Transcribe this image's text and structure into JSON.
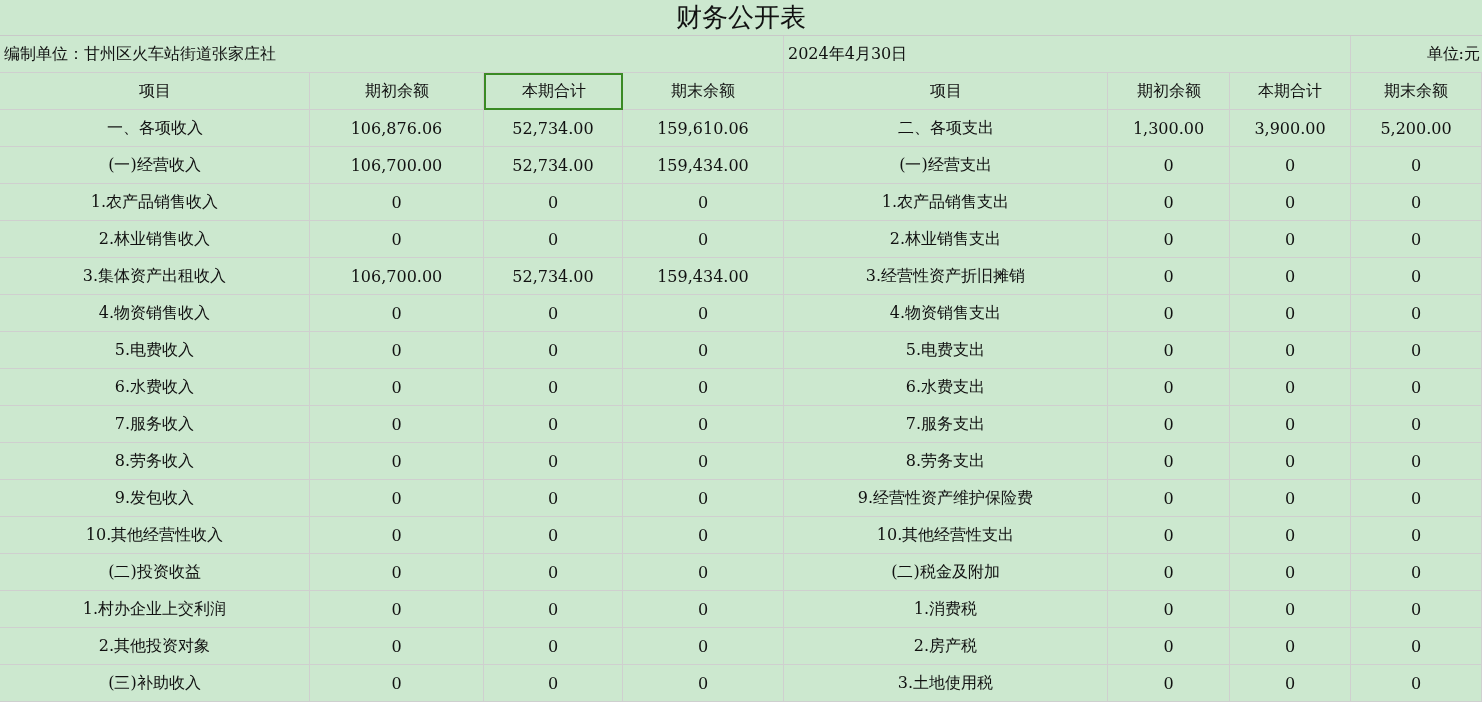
{
  "title": "财务公开表",
  "info": {
    "unit_name": "编制单位：甘州区火车站街道张家庄社",
    "date": "2024年4月30日",
    "currency": "单位:元"
  },
  "columns": [
    {
      "label": "项目",
      "selected": false
    },
    {
      "label": "期初余额",
      "selected": false
    },
    {
      "label": "本期合计",
      "selected": true
    },
    {
      "label": "期末余额",
      "selected": false
    },
    {
      "label": "项目",
      "selected": false
    },
    {
      "label": "期初余额",
      "selected": false
    },
    {
      "label": "本期合计",
      "selected": false
    },
    {
      "label": "期末余额",
      "selected": false
    }
  ],
  "rows": [
    [
      "一、各项收入",
      "106,876.06",
      "52,734.00",
      "159,610.06",
      "二、各项支出",
      "1,300.00",
      "3,900.00",
      "5,200.00"
    ],
    [
      "(一)经营收入",
      "106,700.00",
      "52,734.00",
      "159,434.00",
      "(一)经营支出",
      "0",
      "0",
      "0"
    ],
    [
      "1.农产品销售收入",
      "0",
      "0",
      "0",
      "1.农产品销售支出",
      "0",
      "0",
      "0"
    ],
    [
      "2.林业销售收入",
      "0",
      "0",
      "0",
      "2.林业销售支出",
      "0",
      "0",
      "0"
    ],
    [
      "3.集体资产出租收入",
      "106,700.00",
      "52,734.00",
      "159,434.00",
      "3.经营性资产折旧摊销",
      "0",
      "0",
      "0"
    ],
    [
      "4.物资销售收入",
      "0",
      "0",
      "0",
      "4.物资销售支出",
      "0",
      "0",
      "0"
    ],
    [
      "5.电费收入",
      "0",
      "0",
      "0",
      "5.电费支出",
      "0",
      "0",
      "0"
    ],
    [
      "6.水费收入",
      "0",
      "0",
      "0",
      "6.水费支出",
      "0",
      "0",
      "0"
    ],
    [
      "7.服务收入",
      "0",
      "0",
      "0",
      "7.服务支出",
      "0",
      "0",
      "0"
    ],
    [
      "8.劳务收入",
      "0",
      "0",
      "0",
      "8.劳务支出",
      "0",
      "0",
      "0"
    ],
    [
      "9.发包收入",
      "0",
      "0",
      "0",
      "9.经营性资产维护保险费",
      "0",
      "0",
      "0"
    ],
    [
      "10.其他经营性收入",
      "0",
      "0",
      "0",
      "10.其他经营性支出",
      "0",
      "0",
      "0"
    ],
    [
      "(二)投资收益",
      "0",
      "0",
      "0",
      "(二)税金及附加",
      "0",
      "0",
      "0"
    ],
    [
      "1.村办企业上交利润",
      "0",
      "0",
      "0",
      "1.消费税",
      "0",
      "0",
      "0"
    ],
    [
      "2.其他投资对象",
      "0",
      "0",
      "0",
      "2.房产税",
      "0",
      "0",
      "0"
    ],
    [
      "(三)补助收入",
      "0",
      "0",
      "0",
      "3.土地使用税",
      "0",
      "0",
      "0"
    ]
  ]
}
